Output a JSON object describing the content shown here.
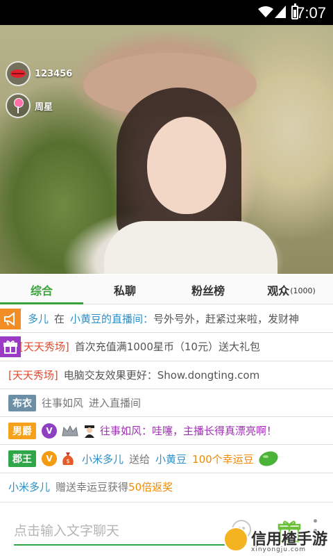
{
  "status_bar": {
    "time": "7:07"
  },
  "hero": {
    "badges": [
      {
        "icon": "lips-icon",
        "label": "123456"
      },
      {
        "icon": "candy-icon",
        "label": "周星"
      }
    ]
  },
  "tabs": [
    {
      "label": "综合",
      "active": true
    },
    {
      "label": "私聊"
    },
    {
      "label": "粉丝榜"
    },
    {
      "label": "观众",
      "count": "(1000)"
    }
  ],
  "chat": {
    "row1": {
      "user": "多儿",
      "prep": "在",
      "room": "小黄豆的直播间：",
      "msg": "号外号外，赶紧过来啦，发财神"
    },
    "row2": {
      "tag": "[天天秀场]",
      "msg": "首次充值满1000星币（10元）送大礼包"
    },
    "row3": {
      "tag": "[天天秀场]",
      "msg": "电脑交友效果更好：Show.dongting.com"
    },
    "row4": {
      "rank": "布衣",
      "user": "往事如风",
      "action": "进入直播间"
    },
    "row5": {
      "rank": "男爵",
      "v": "V",
      "msg": "往事如风：哇噻，主播长得真漂亮啊！"
    },
    "row6": {
      "rank": "郡王",
      "v": "V",
      "user": "小米多儿",
      "verb": "送给",
      "target": "小黄豆",
      "gift": "100个幸运豆"
    },
    "row7": {
      "user": "小米多儿",
      "text": "赠送幸运豆获得",
      "reward": "50倍返奖"
    }
  },
  "input": {
    "placeholder": "点击输入文字聊天"
  },
  "watermark": {
    "text": "信用楂手游",
    "sub": "xinyongju.com"
  },
  "colors": {
    "accent": "#3aa23a",
    "link": "#2a8fc8",
    "purple": "#a12fb5",
    "orange": "#f08a00"
  }
}
